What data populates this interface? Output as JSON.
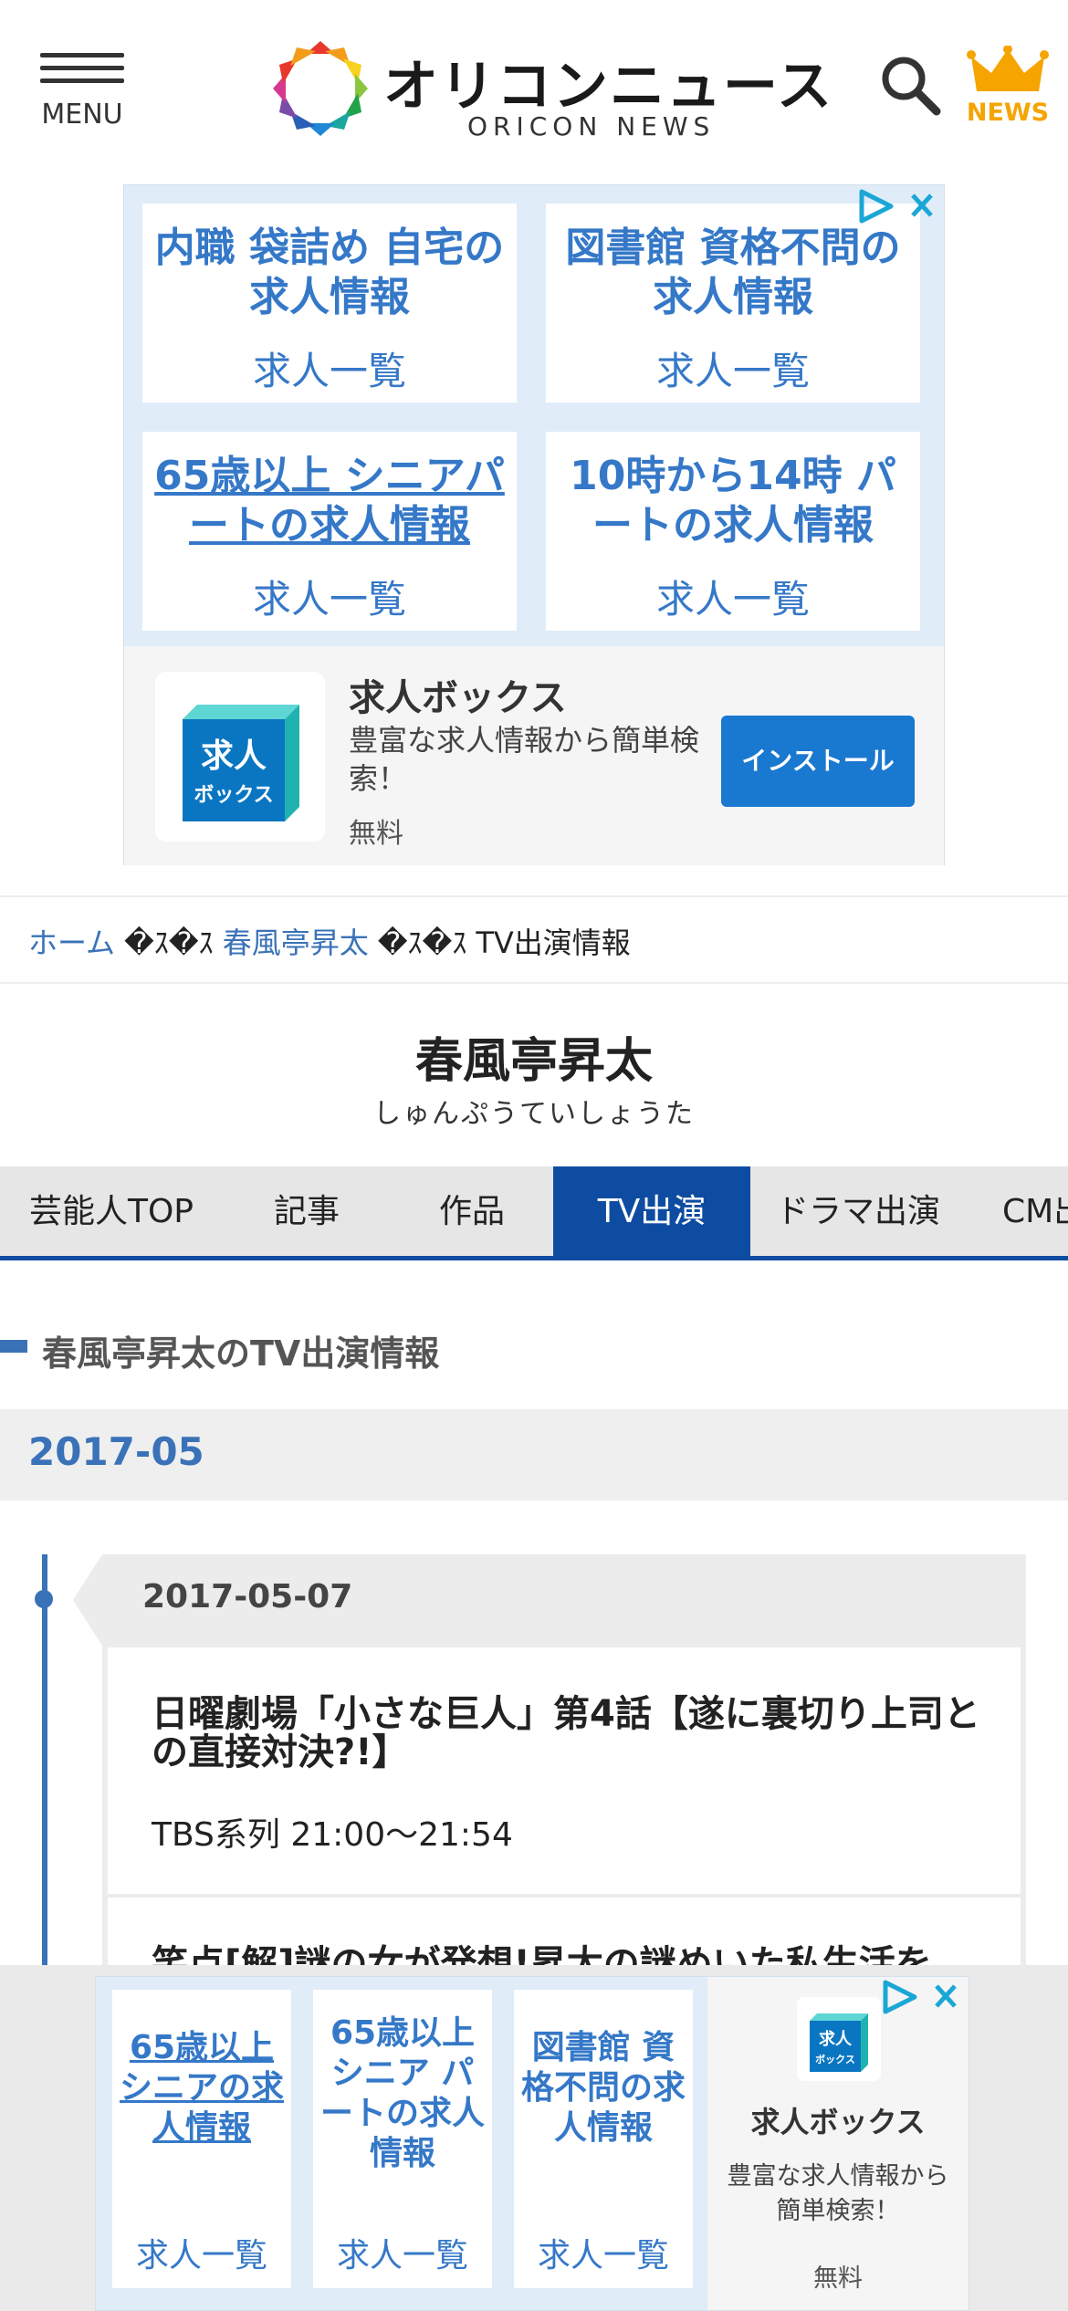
{
  "header": {
    "menu_label": "MENU",
    "logo_title": "オリコンニュース",
    "logo_subtitle": "ORICON NEWS",
    "news_label": "NEWS"
  },
  "ad_top": {
    "cells": [
      {
        "title": "内職 袋詰め 自宅の求人情報",
        "sub": "求人一覧"
      },
      {
        "title": "図書館 資格不問の求人情報",
        "sub": "求人一覧"
      },
      {
        "title": "65歳以上 シニアパートの求人情報",
        "sub": "求人一覧"
      },
      {
        "title": "10時から14時 パートの求人情報",
        "sub": "求人一覧"
      }
    ],
    "app": {
      "icon_text_1": "求人",
      "icon_text_2": "ボックス",
      "name": "求人ボックス",
      "description": "豊富な求人情報から簡単検索！",
      "price": "無料",
      "install_label": "インストール"
    }
  },
  "breadcrumb": {
    "home": "ホーム",
    "separator": "�ｽ�ｽ",
    "person": "春風亭昇太",
    "current": "TV出演情報"
  },
  "person": {
    "name": "春風亭昇太",
    "kana": "しゅんぷうていしょうた"
  },
  "tabs": [
    "芸能人TOP",
    "記事",
    "作品",
    "TV出演",
    "ドラマ出演",
    "CM出"
  ],
  "active_tab": "TV出演",
  "section_title": "春風亭昇太のTV出演情報",
  "month": "2017-05",
  "day": {
    "date": "2017-05-07",
    "entries": [
      {
        "title": "日曜劇場「小さな巨人」第4話【遂に裏切り上司との直接対決?!】",
        "meta": "TBS系列 21:00〜21:54"
      },
      {
        "title": "笑点[解]謎の女が発想!昇太の謎めいた私生活を",
        "meta": ""
      }
    ]
  },
  "ad_bottom": {
    "cells": [
      {
        "title": "65歳以上 シニアの求人情報",
        "sub": "求人一覧"
      },
      {
        "title": "65歳以上 シニア パートの求人情報",
        "sub": "求人一覧"
      },
      {
        "title": "図書館 資格不問の求人情報",
        "sub": "求人一覧"
      }
    ],
    "app": {
      "icon_text_1": "求人",
      "icon_text_2": "ボックス",
      "name": "求人ボックス",
      "description": "豊富な求人情報から簡単検索！",
      "price": "無料"
    }
  },
  "colors": {
    "brand_blue": "#0e4ca1",
    "link_blue": "#3a72b8",
    "ad_blue": "#3578c8",
    "install_blue": "#1978d0",
    "crown_orange": "#f5a400"
  }
}
